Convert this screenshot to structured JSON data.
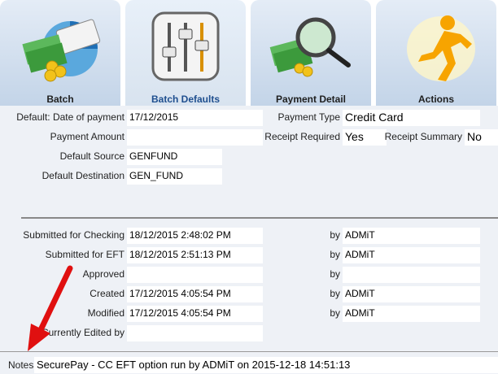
{
  "tabs": [
    {
      "label": "Batch",
      "icon": "batch-icon"
    },
    {
      "label": "Batch Defaults",
      "icon": "sliders-icon",
      "active": true
    },
    {
      "label": "Payment Detail",
      "icon": "magnifier-icon"
    },
    {
      "label": "Actions",
      "icon": "running-man-icon"
    }
  ],
  "defaults": {
    "date_label": "Default: Date of payment",
    "date_value": "17/12/2015",
    "payment_type_label": "Payment Type",
    "payment_type_value": "Credit Card",
    "amount_label": "Payment Amount",
    "amount_value": "",
    "receipt_required_label": "Receipt Required",
    "receipt_required_value": "Yes",
    "receipt_summary_label": "Receipt Summary",
    "receipt_summary_value": "No",
    "source_label": "Default Source",
    "source_value": "GENFUND",
    "destination_label": "Default Destination",
    "destination_value": "GEN_FUND"
  },
  "audit": {
    "by_label": "by",
    "rows": [
      {
        "label": "Submitted for Checking",
        "value": "18/12/2015 2:48:02 PM",
        "by": "ADMiT"
      },
      {
        "label": "Submitted for EFT",
        "value": "18/12/2015 2:51:13 PM",
        "by": "ADMiT"
      },
      {
        "label": "Approved",
        "value": "",
        "by": ""
      },
      {
        "label": "Created",
        "value": "17/12/2015 4:05:54 PM",
        "by": "ADMiT"
      },
      {
        "label": "Modified",
        "value": "17/12/2015 4:05:54 PM",
        "by": "ADMiT"
      }
    ],
    "edited_label": "Currently Edited by",
    "edited_value": ""
  },
  "notes": {
    "label": "Notes",
    "value": "SecurePay - CC EFT option run by ADMiT on 2015-12-18 14:51:13"
  },
  "colors": {
    "tab_bg": "#c3d4e8",
    "panel_bg": "#eef1f6",
    "active_tab_text": "#1f4f8f",
    "arrow": "#e01010"
  }
}
